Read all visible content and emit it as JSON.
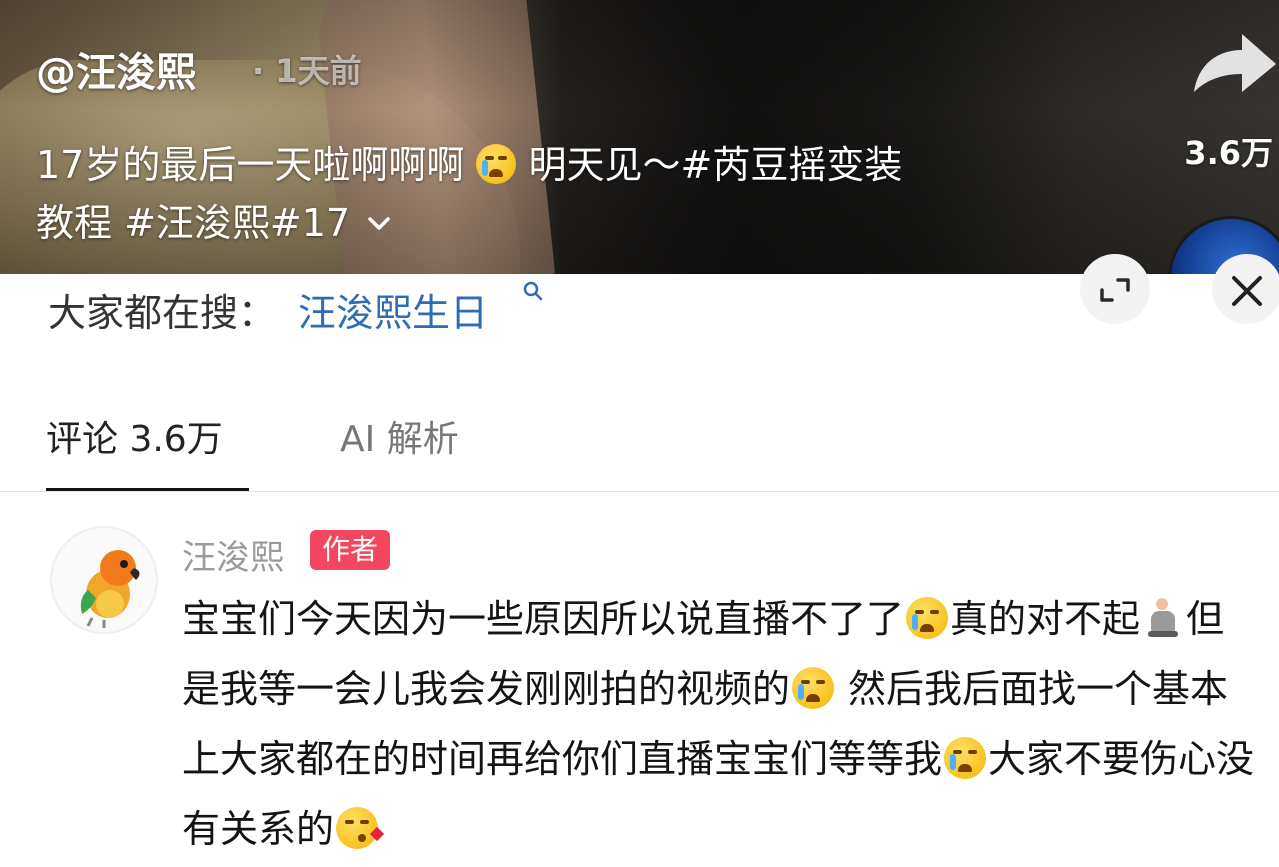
{
  "video": {
    "author_handle": "@汪浚熙",
    "post_time": "· 1天前",
    "caption_part1": "17岁的最后一天啦啊啊啊",
    "caption_part2": "明天见～#芮豆摇变装",
    "caption_part3": "教程 #汪浚熙#17",
    "share_count": "3.6万"
  },
  "search": {
    "label": "大家都在搜：",
    "term": "汪浚熙生日"
  },
  "tabs": [
    {
      "label": "评论 3.6万",
      "active": true
    },
    {
      "label": "AI 解析",
      "active": false
    }
  ],
  "comment": {
    "username": "汪浚熙",
    "badge": "作者",
    "segments": [
      "宝宝们今天因为一些原因所以说直播不了了",
      "真的对不起",
      "但是我等一会儿我会发刚刚拍的视频的",
      "然后我后面找一个基本上大家都在的时间再给你们直播宝宝们等等我",
      "大家不要伤心没有关系的"
    ]
  },
  "icons": {
    "share": "share-arrow-icon",
    "expand": "expand-icon",
    "close": "close-icon",
    "search": "search-icon",
    "caption_chevron": "chevron-down-icon"
  },
  "colors": {
    "search_term": "#2f6cb3",
    "badge": "#f2475e",
    "active_tab_underline": "#161616"
  }
}
